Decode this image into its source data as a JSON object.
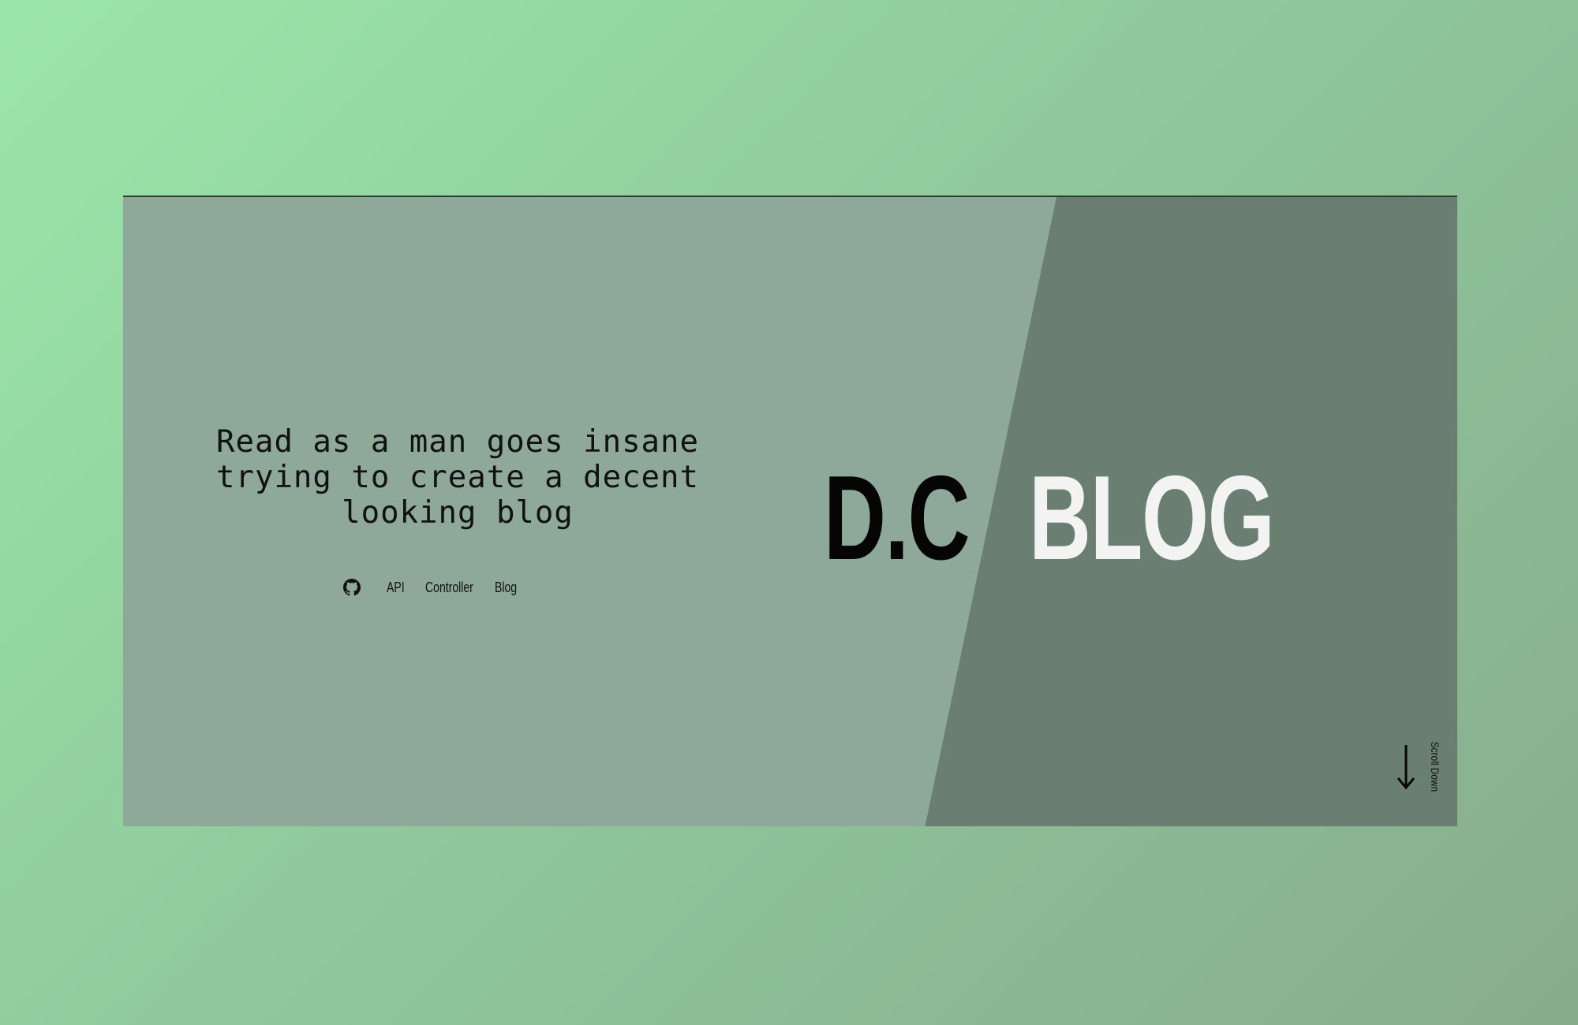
{
  "hero": {
    "tagline": "Read as a man goes insane trying to create a decent looking blog",
    "brand_left": "D.C",
    "brand_right": "BLOG",
    "scroll_label": "Scroll Down"
  },
  "nav": {
    "icon": "github-icon",
    "items": [
      {
        "label": "API"
      },
      {
        "label": "Controller"
      },
      {
        "label": "Blog"
      }
    ]
  },
  "colors": {
    "page_gradient_start": "#9ae6a9",
    "page_gradient_end": "#88ac8c",
    "hero_light": "#8ea99a",
    "hero_dark": "#6a7f71",
    "brand_left": "#050505",
    "brand_right": "#f3f3f3"
  }
}
